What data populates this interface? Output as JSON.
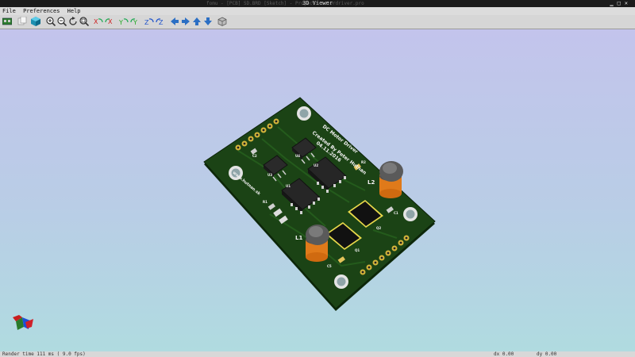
{
  "window": {
    "title": "3D Viewer",
    "title_faded": "fomu - [PCB] SD.BRD [Sketch] - Project: motordriver.pro"
  },
  "menu": {
    "items": [
      "File",
      "Preferences",
      "Help"
    ]
  },
  "toolbar": {
    "icons": [
      "reload-board-icon",
      "copy-image-icon",
      "render-options-icon",
      "zoom-in-icon",
      "zoom-out-icon",
      "redraw-icon",
      "zoom-fit-icon",
      "rotate-x-cw-icon",
      "rotate-x-ccw-icon",
      "rotate-y-cw-icon",
      "rotate-y-ccw-icon",
      "rotate-z-cw-icon",
      "rotate-z-ccw-icon",
      "pan-left-icon",
      "pan-right-icon",
      "pan-up-icon",
      "pan-down-icon",
      "orthographic-toggle-icon"
    ]
  },
  "board": {
    "silk_title": "DC Motor Driver",
    "silk_line2": "Created By Peter Hutnan",
    "silk_date": "04.11.2016",
    "silk_url": "www.hutnan.sk",
    "refs": {
      "u1": "U1",
      "u2": "U2",
      "u3": "U3",
      "u4": "U4",
      "l1": "L1",
      "l2": "L2",
      "q1": "Q1",
      "q2": "Q2",
      "c1": "C1",
      "c2": "C2",
      "c5": "C5",
      "r1": "R1",
      "r2": "R2"
    },
    "colors": {
      "soldermask": "#173a12",
      "copper": "#c8a82a",
      "silk": "#f0f0f0"
    }
  },
  "status": {
    "render_time": "Render time 111 ms ( 9.0 fps)",
    "dx": "dx 0.00",
    "dy": "dy 0.00"
  }
}
